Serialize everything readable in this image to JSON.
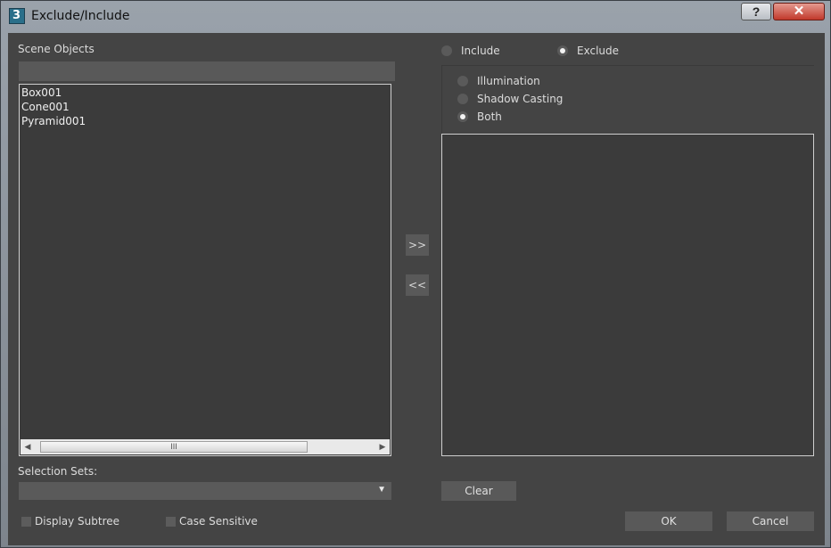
{
  "window": {
    "title": "Exclude/Include",
    "help_label": "?",
    "close_label": "✕",
    "app_icon_glyph": "3"
  },
  "scene_objects": {
    "label": "Scene Objects",
    "filter_value": "",
    "items": [
      "Box001",
      "Cone001",
      "Pyramid001"
    ],
    "scroll_left": "◀",
    "scroll_right": "▶",
    "scroll_grip": "III"
  },
  "mode": {
    "include_label": "Include",
    "exclude_label": "Exclude",
    "selected": "Exclude"
  },
  "effect": {
    "illumination_label": "Illumination",
    "shadow_casting_label": "Shadow Casting",
    "both_label": "Both",
    "selected": "Both"
  },
  "transfer": {
    "add_label": ">>",
    "remove_label": "<<"
  },
  "selection_sets": {
    "label": "Selection Sets:",
    "value": "",
    "caret": "▼"
  },
  "options": {
    "display_subtree_label": "Display Subtree",
    "case_sensitive_label": "Case Sensitive"
  },
  "buttons": {
    "clear_label": "Clear",
    "ok_label": "OK",
    "cancel_label": "Cancel"
  }
}
